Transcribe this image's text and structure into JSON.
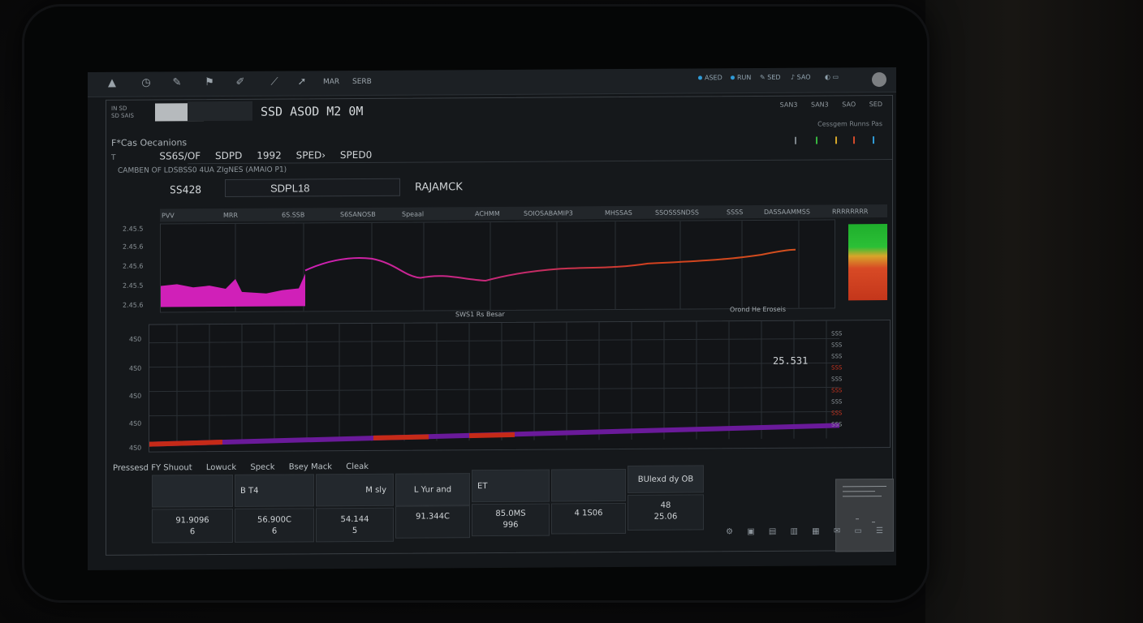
{
  "toolbar": {
    "text1": "MAR",
    "text2": "SERB",
    "right_labels": [
      "ASED",
      "RUN",
      "SED",
      "SAO"
    ]
  },
  "window": {
    "small_labels": [
      "IN SD",
      "SD SAIS"
    ],
    "title": "SSD ASOD M2 0M",
    "top_right": [
      "SAN3",
      "SAN3",
      "SAO",
      "SED"
    ],
    "top_right_sub": "Cessgem Runns Pas"
  },
  "section": {
    "label": "F*Cas Oecanions",
    "nav_prefix": "T",
    "nav": [
      "SS6S/OF",
      "SDPD",
      "1992",
      "SPED›",
      "SPED0"
    ],
    "description": "CAMBEN OF LDSBSS0 4UA ZIgNES (AMAIO P1)"
  },
  "fields": {
    "left_label": "SS428",
    "input_value": "SDPL18",
    "right_label": "RAJAMCK"
  },
  "chart1": {
    "y_labels": [
      "2.45.5",
      "2.45.6",
      "2.45.6",
      "2.45.5",
      "2.45.6"
    ],
    "headers": [
      "PVV",
      "MRR",
      "6S.SSB",
      "S6SANOSB",
      "Speaal",
      "ACHMM",
      "SOIOSABAMIP3",
      "MHSSAS",
      "SSOSSSNDSS",
      "SSSS",
      "DASSAAMMSS",
      "RRRRRRRR"
    ],
    "footer_center": "SWS1 Rs Besar",
    "footer_right": "Orond He Eroseis"
  },
  "chart2": {
    "y_labels": [
      "4S0",
      "4S0",
      "4S0",
      "4S0",
      "4S0"
    ],
    "value_readout": "25.531",
    "right_ticks": [
      "SSS",
      "SSS",
      "SSS",
      "SSS",
      "SSS",
      "SSS",
      "SSS",
      "SSS",
      "SSS"
    ]
  },
  "table": {
    "title_parts": [
      "Pressesd FY Shuout",
      "Lowuck",
      "Speck",
      "Bsey Mack",
      "Cleak"
    ],
    "headers": [
      "",
      "B T4",
      "M sly",
      "L    Yur   and",
      "ET",
      "",
      "BUlexd dy OB"
    ],
    "rows": [
      [
        "91.9096\n6",
        "56.900C\n6",
        "54.144\n5",
        "91.344C",
        "85.0MS\n996",
        "4 1S06",
        "48\n25.06"
      ]
    ]
  },
  "taskbar": [
    "⚙",
    "▣",
    "▤",
    "▥",
    "▦",
    "✉",
    "▭",
    "☰"
  ],
  "colors": {
    "magenta": "#d020b8",
    "red_line": "#d2401e",
    "purple_bar": "#6a1a9a",
    "red_bar": "#c52a18",
    "green": "#22b333"
  }
}
